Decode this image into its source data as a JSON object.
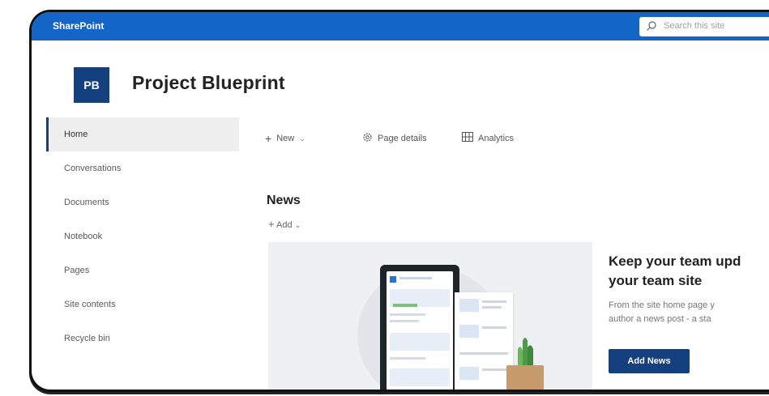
{
  "app": {
    "brand": "SharePoint"
  },
  "search": {
    "placeholder": "Search this site"
  },
  "site": {
    "logo_initials": "PB",
    "title": "Project Blueprint"
  },
  "nav": {
    "items": [
      {
        "label": "Home",
        "active": true
      },
      {
        "label": "Conversations"
      },
      {
        "label": "Documents"
      },
      {
        "label": "Notebook"
      },
      {
        "label": "Pages"
      },
      {
        "label": "Site contents"
      },
      {
        "label": "Recycle bin"
      }
    ]
  },
  "commands": {
    "new": "New",
    "page_details": "Page details",
    "analytics": "Analytics"
  },
  "news": {
    "title": "News",
    "add": "Add",
    "cta_title_1": "Keep your team upd",
    "cta_title_2": "your team site",
    "cta_desc_1": "From the site home page y",
    "cta_desc_2": "author a news post - a sta",
    "cta_button": "Add News"
  },
  "colors": {
    "brand_bar": "#1465c8",
    "accent": "#14407f"
  }
}
